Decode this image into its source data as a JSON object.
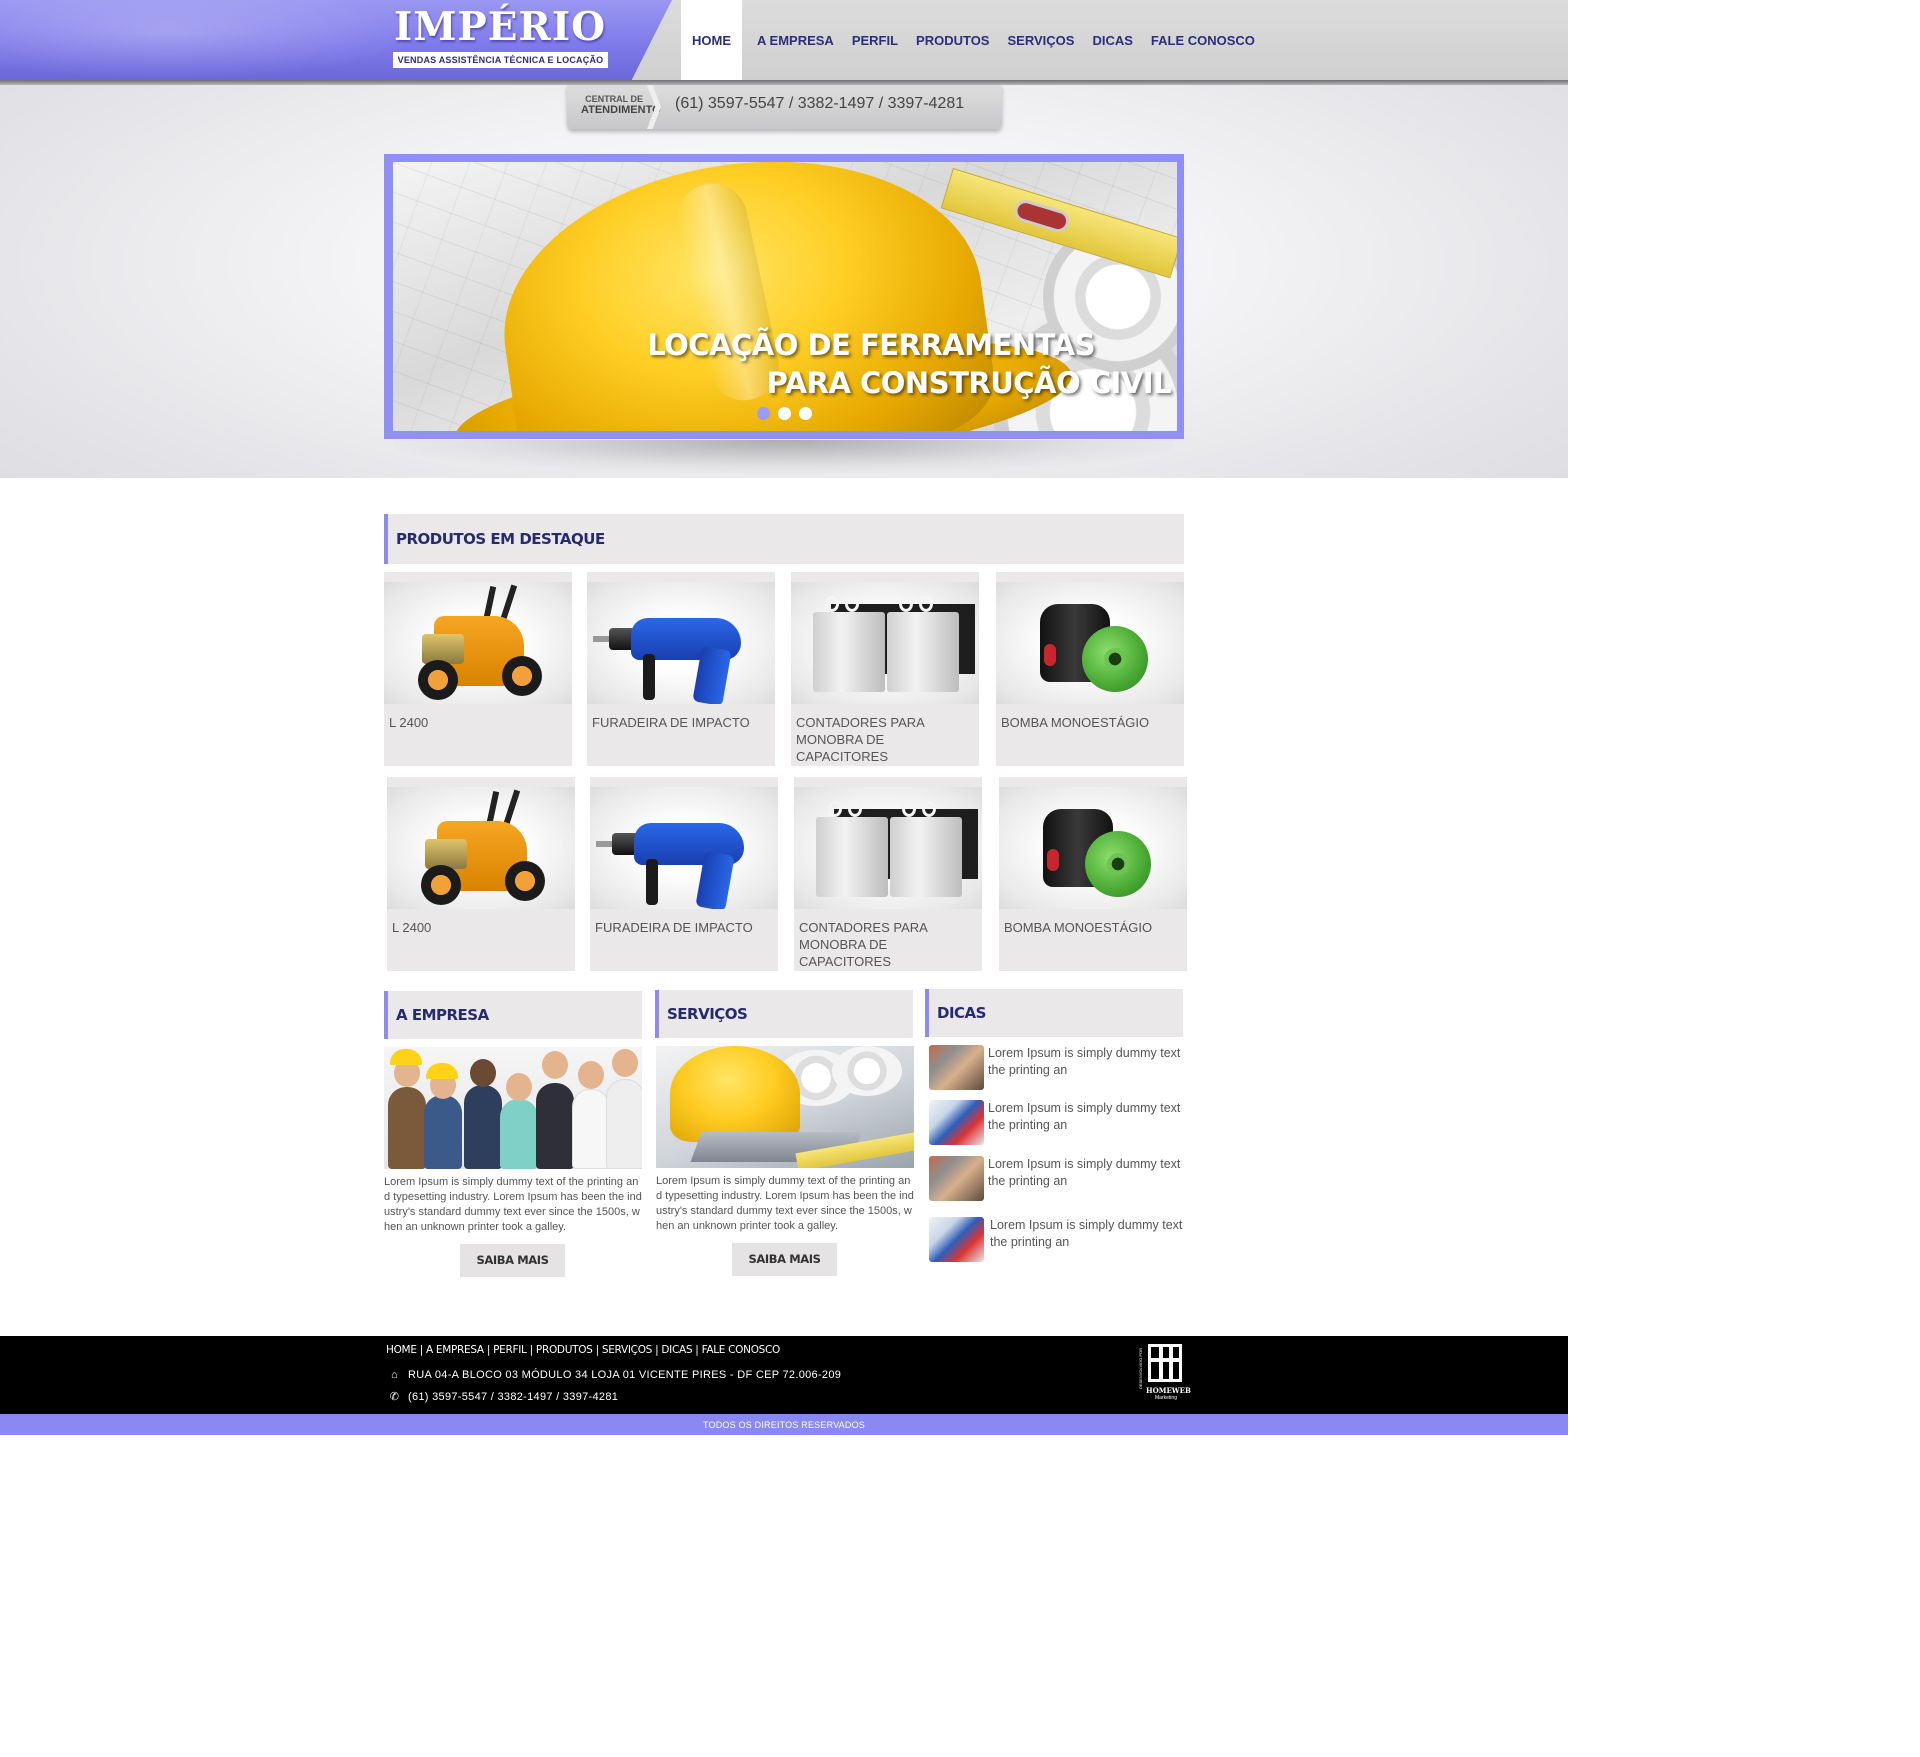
{
  "brand": {
    "name": "IMPÉRIO",
    "tagline": "VENDAS ASSISTÊNCIA TÉCNICA E LOCAÇÃO",
    "accent_color": "#8a89f3",
    "dark_color": "#262a6e"
  },
  "nav": {
    "items": [
      "HOME",
      "A EMPRESA",
      "PERFIL",
      "PRODUTOS",
      "SERVIÇOS",
      "DICAS",
      "FALE CONOSCO"
    ],
    "active": "HOME"
  },
  "contact_bar": {
    "label_top": "CENTRAL DE",
    "label_bottom": "ATENDIMENTO",
    "phone": "(61) 3597-5547 / 3382-1497 / 3397-4281"
  },
  "slider": {
    "line1": "LOCAÇÃO DE FERRAMENTAS",
    "line2": "PARA CONSTRUÇÃO CIVIL",
    "slide_count": 3,
    "active_slide": 1
  },
  "featured": {
    "title": "PRODUTOS EM DESTAQUE",
    "products": [
      {
        "name": "L 2400",
        "icon": "pressure-washer-image"
      },
      {
        "name": "FURADEIRA DE IMPACTO",
        "icon": "impact-drill-image"
      },
      {
        "name": "CONTADORES PARA MONOBRA DE CAPACITORES",
        "icon": "contactors-image"
      },
      {
        "name": "BOMBA MONOESTÁGIO",
        "icon": "water-pump-image"
      },
      {
        "name": "L 2400",
        "icon": "pressure-washer-image"
      },
      {
        "name": "FURADEIRA DE IMPACTO",
        "icon": "impact-drill-image"
      },
      {
        "name": "CONTADORES PARA MONOBRA DE CAPACITORES",
        "icon": "contactors-image"
      },
      {
        "name": "BOMBA MONOESTÁGIO",
        "icon": "water-pump-image"
      }
    ]
  },
  "empresa": {
    "title": "A EMPRESA",
    "text": "Lorem Ipsum is simply dummy text of the printing and typesetting industry. Lorem Ipsum has been the industry's standard dummy text ever since the 1500s, when an unknown printer took a galley.",
    "button": "SAIBA MAIS"
  },
  "servicos": {
    "title": "SERVIÇOS",
    "text": "Lorem Ipsum is simply dummy text of the printing and typesetting industry. Lorem Ipsum has been the industry's standard dummy text ever since the 1500s, when an unknown printer took a galley.",
    "button": "SAIBA MAIS"
  },
  "dicas": {
    "title": "DICAS",
    "items": [
      {
        "text": "Lorem Ipsum is simply dummy text the printing an"
      },
      {
        "text": "Lorem Ipsum is simply dummy text the printing an"
      },
      {
        "text": "Lorem Ipsum is simply dummy text the printing an"
      },
      {
        "text": "Lorem Ipsum is simply dummy text the printing an"
      }
    ]
  },
  "footer": {
    "nav": [
      "HOME",
      "A EMPRESA",
      "PERFIL",
      "PRODUTOS",
      "SERVIÇOS",
      "DICAS",
      "FALE CONOSCO"
    ],
    "address": "RUA 04-A BLOCO 03 MÓDULO 34 LOJA 01 VICENTE PIRES - DF CEP 72.006-209",
    "phone": "(61) 3597-5547 / 3382-1497 / 3397-4281",
    "developer_label": "DESENVOLVIDO POR",
    "developer_name": "HOMEWEB",
    "developer_sub": "Marketing",
    "copyright": "TODOS OS DIREITOS RESERVADOS"
  }
}
